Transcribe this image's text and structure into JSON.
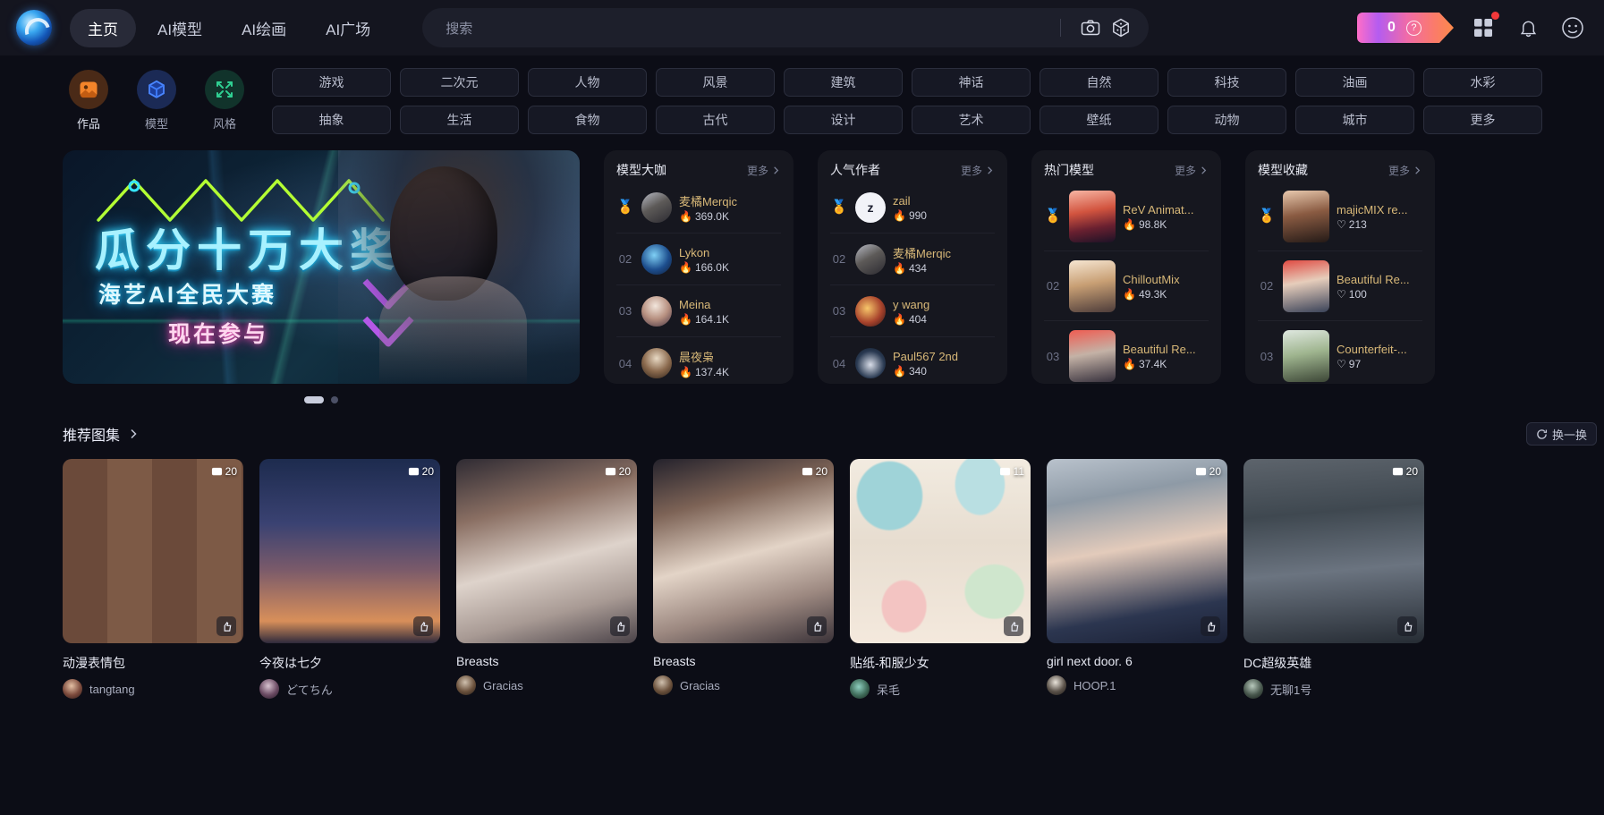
{
  "header": {
    "logo_icon": "liblib-swirl-logo",
    "nav": [
      {
        "label": "主页",
        "active": true
      },
      {
        "label": "AI模型",
        "active": false
      },
      {
        "label": "AI绘画",
        "active": false
      },
      {
        "label": "AI广场",
        "active": false
      }
    ],
    "search": {
      "placeholder": "搜索",
      "value": ""
    },
    "icons": [
      {
        "name": "camera-icon"
      },
      {
        "name": "dice-3d-cube-icon"
      }
    ],
    "energy": {
      "value": "0",
      "help": "?",
      "bolt_icon": "crown-lightning-icon"
    },
    "apps_icon": "grid-apps-icon",
    "notification_icon": "bell-icon",
    "avatar_icon": "user-avatar-icon",
    "badge_color": "#f2383a"
  },
  "modes": [
    {
      "label": "作品",
      "icon": "image-artwork-icon",
      "active": true
    },
    {
      "label": "模型",
      "icon": "cube-model-icon",
      "active": false
    },
    {
      "label": "风格",
      "icon": "style-arrows-icon",
      "active": false
    }
  ],
  "categories": {
    "row1": [
      "游戏",
      "二次元",
      "人物",
      "风景",
      "建筑",
      "神话",
      "自然",
      "科技",
      "油画",
      "水彩"
    ],
    "row2": [
      "抽象",
      "生活",
      "食物",
      "古代",
      "设计",
      "艺术",
      "壁纸",
      "动物",
      "城市",
      "更多"
    ]
  },
  "banner": {
    "title": "瓜分十万大奖",
    "subtitle": "海艺AI全民大赛",
    "cta": "现在参与",
    "dots": 2,
    "active_dot": 0
  },
  "panels": [
    {
      "title": "模型大咖",
      "more": "更多",
      "stat_icon": "flame-icon",
      "avatar_shape": "circle",
      "items": [
        {
          "rank": "01",
          "medal": "🏅",
          "name": "麦橘Merqic",
          "stat": "369.0K"
        },
        {
          "rank": "02",
          "medal": "",
          "name": "Lykon",
          "stat": "166.0K"
        },
        {
          "rank": "03",
          "medal": "",
          "name": "Meina",
          "stat": "164.1K"
        },
        {
          "rank": "04",
          "medal": "",
          "name": "晨夜枭",
          "stat": "137.4K"
        }
      ]
    },
    {
      "title": "人气作者",
      "more": "更多",
      "stat_icon": "flame-icon",
      "avatar_shape": "circle",
      "items": [
        {
          "rank": "01",
          "medal": "🏅",
          "name": "zail",
          "stat": "990"
        },
        {
          "rank": "02",
          "medal": "",
          "name": "麦橘Merqic",
          "stat": "434"
        },
        {
          "rank": "03",
          "medal": "",
          "name": "y wang",
          "stat": "404"
        },
        {
          "rank": "04",
          "medal": "",
          "name": "Paul567 2nd",
          "stat": "340"
        }
      ]
    },
    {
      "title": "热门模型",
      "more": "更多",
      "stat_icon": "flame-icon",
      "avatar_shape": "square",
      "items": [
        {
          "rank": "01",
          "medal": "🏅",
          "name": "ReV Animat...",
          "stat": "98.8K"
        },
        {
          "rank": "02",
          "medal": "",
          "name": "ChilloutMix",
          "stat": "49.3K"
        },
        {
          "rank": "03",
          "medal": "",
          "name": "Beautiful Re...",
          "stat": "37.4K"
        }
      ]
    },
    {
      "title": "模型收藏",
      "more": "更多",
      "stat_icon": "heart-icon",
      "avatar_shape": "square",
      "items": [
        {
          "rank": "01",
          "medal": "🏅",
          "name": "majicMIX re...",
          "stat": "213"
        },
        {
          "rank": "02",
          "medal": "",
          "name": "Beautiful Re...",
          "stat": "100"
        },
        {
          "rank": "03",
          "medal": "",
          "name": "Counterfeit-...",
          "stat": "97"
        }
      ]
    }
  ],
  "recommend": {
    "title": "推荐图集",
    "refresh_label": "换一换",
    "refresh_icon": "refresh-icon",
    "cards": [
      {
        "count": "20",
        "title": "动漫表情包",
        "user": "tangtang"
      },
      {
        "count": "20",
        "title": "今夜は七夕",
        "user": "どてちん"
      },
      {
        "count": "20",
        "title": "Breasts",
        "user": "Gracias"
      },
      {
        "count": "20",
        "title": "Breasts",
        "user": "Gracias"
      },
      {
        "count": "11",
        "title": "贴纸-和服少女",
        "user": "呆毛"
      },
      {
        "count": "20",
        "title": "girl next door. 6",
        "user": "HOOP.1"
      },
      {
        "count": "20",
        "title": "DC超级英雄",
        "user": "无聊1号"
      }
    ]
  }
}
